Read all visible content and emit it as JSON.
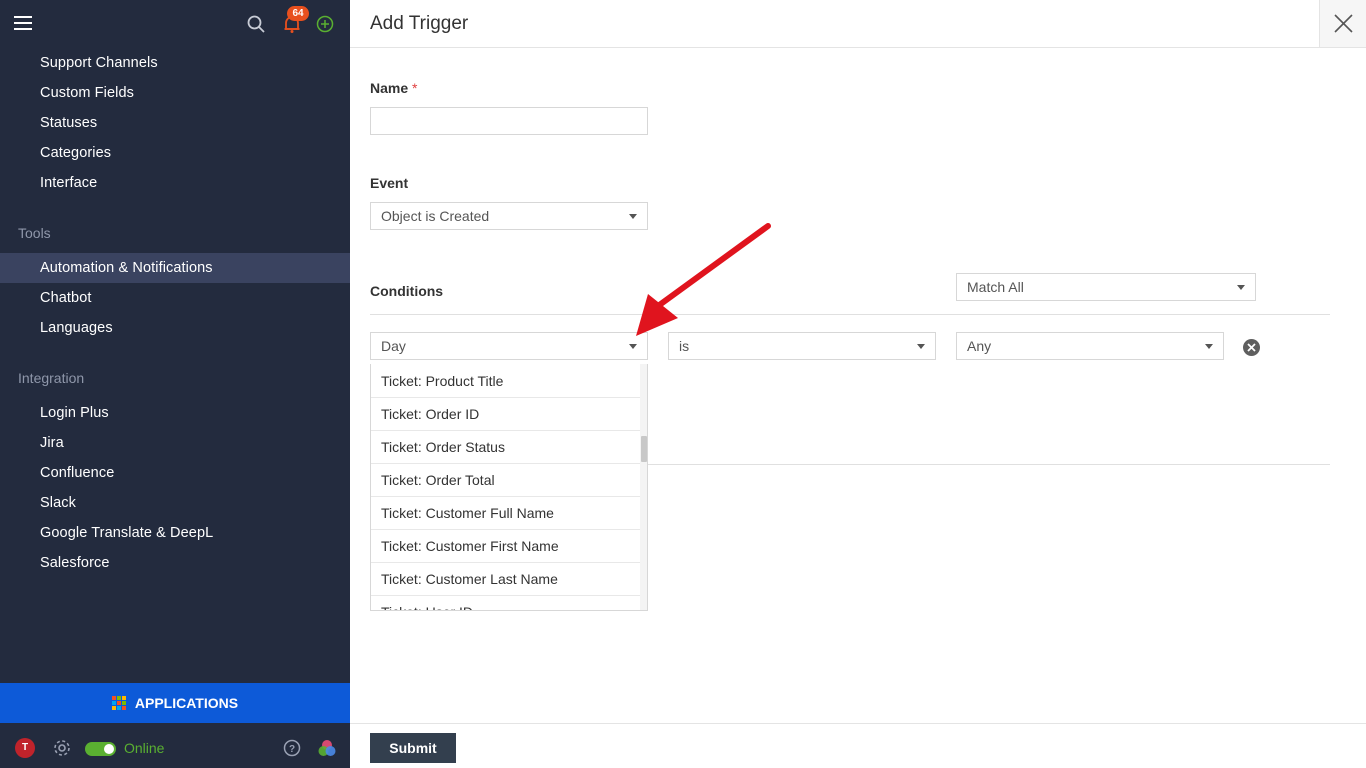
{
  "sidebar": {
    "notification_count": "64",
    "items_top": [
      {
        "label": "Support Channels"
      },
      {
        "label": "Custom Fields"
      },
      {
        "label": "Statuses"
      },
      {
        "label": "Categories"
      },
      {
        "label": "Interface"
      }
    ],
    "tools_heading": "Tools",
    "tools": [
      {
        "label": "Automation & Notifications",
        "active": true
      },
      {
        "label": "Chatbot"
      },
      {
        "label": "Languages"
      }
    ],
    "integration_heading": "Integration",
    "integrations": [
      {
        "label": "Login Plus"
      },
      {
        "label": "Jira"
      },
      {
        "label": "Confluence"
      },
      {
        "label": "Slack"
      },
      {
        "label": "Google Translate & DeepL"
      },
      {
        "label": "Salesforce"
      }
    ],
    "applications_label": "APPLICATIONS",
    "user_initial": "T",
    "status_label": "Online"
  },
  "colors": {
    "sidebar_bg": "#232b3e",
    "active_item": "#3a4360",
    "applications_bar": "#0d5ad8",
    "online_green": "#5ab031",
    "badge": "#e8501e",
    "submit_bg": "#333f4e",
    "annotation_arrow": "#e0141e"
  },
  "form": {
    "title": "Add Trigger",
    "name_label": "Name",
    "required_mark": "*",
    "name_value": "",
    "event_label": "Event",
    "event_value": "Object is Created",
    "conditions_label": "Conditions",
    "match_value": "Match All",
    "condition": {
      "field": "Day",
      "operator": "is",
      "value": "Any"
    },
    "dropdown_options": [
      "Ticket: Product Title",
      "Ticket: Order ID",
      "Ticket: Order Status",
      "Ticket: Order Total",
      "Ticket: Customer Full Name",
      "Ticket: Customer First Name",
      "Ticket: Customer Last Name",
      "Ticket: User ID"
    ],
    "submit_label": "Submit"
  }
}
